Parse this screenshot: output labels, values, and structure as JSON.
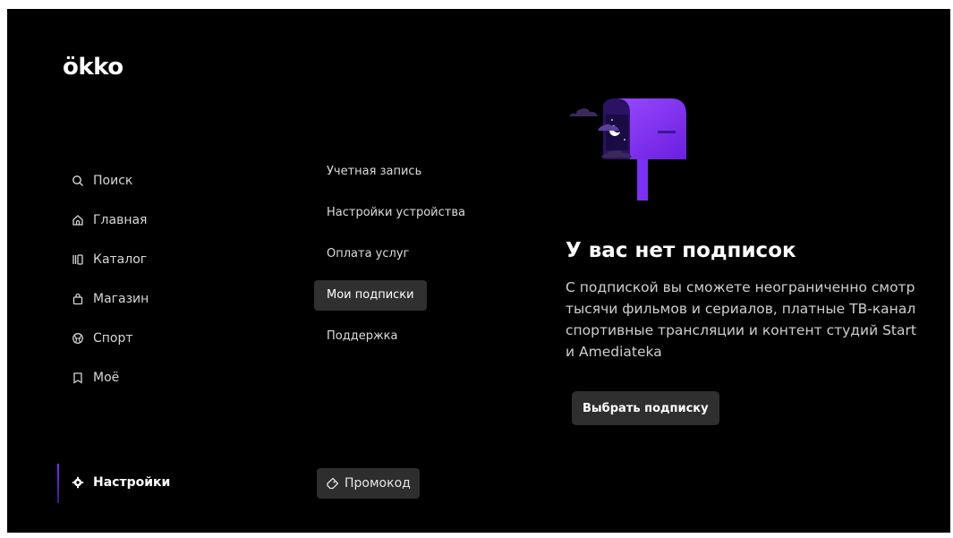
{
  "brand": {
    "logo": "ökko"
  },
  "nav": {
    "items": [
      {
        "label": "Поиск",
        "icon": "search-icon"
      },
      {
        "label": "Главная",
        "icon": "home-icon"
      },
      {
        "label": "Каталог",
        "icon": "catalog-icon"
      },
      {
        "label": "Магазин",
        "icon": "shopping-bag-icon"
      },
      {
        "label": "Спорт",
        "icon": "ball-icon"
      },
      {
        "label": "Моё",
        "icon": "bookmark-icon"
      }
    ],
    "settings_label": "Настройки"
  },
  "submenu": {
    "items": [
      {
        "label": "Учетная запись"
      },
      {
        "label": "Настройки устройства"
      },
      {
        "label": "Оплата услуг"
      },
      {
        "label": "Мои подписки",
        "active": true
      },
      {
        "label": "Поддержка"
      }
    ],
    "promo_label": "Промокод"
  },
  "empty_state": {
    "title": "У вас нет подписок",
    "lines": [
      "С подпиской вы сможете неограниченно смотр",
      "тысячи фильмов и сериалов, платные ТВ-канал",
      "спортивные трансляции и контент студий Start",
      "и Amediateka"
    ],
    "button_label": "Выбрать подписку",
    "illustration": "mailbox-icon"
  },
  "colors": {
    "accent": "#7b2ff7",
    "background": "#000000"
  }
}
